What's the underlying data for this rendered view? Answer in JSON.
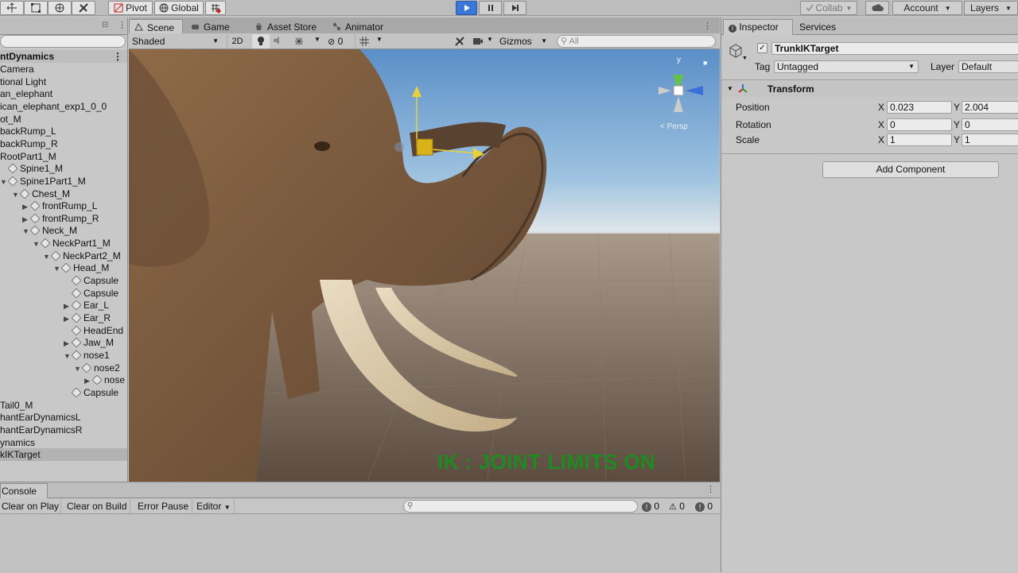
{
  "toolbar": {
    "pivot_label": "Pivot",
    "global_label": "Global",
    "collab_label": "Collab",
    "account_label": "Account",
    "layers_label": "Layers"
  },
  "scene_tabs": [
    {
      "label": "Scene"
    },
    {
      "label": "Game"
    },
    {
      "label": "Asset Store"
    },
    {
      "label": "Animator"
    }
  ],
  "scene_toolbar": {
    "shading": "Shaded",
    "mode_2d": "2D",
    "hidden_count": "0",
    "gizmos_label": "Gizmos",
    "search_placeholder": "All"
  },
  "scene_view": {
    "overlay_text": "IK : JOINT LIMITS ON",
    "overlay_color": "#1f8a1f",
    "persp_label": "< Persp",
    "axis_y_label": "y"
  },
  "hierarchy": {
    "root_label": "ntDynamics",
    "items": [
      {
        "label": "Camera",
        "indent": 0
      },
      {
        "label": "tional Light",
        "indent": 0
      },
      {
        "label": "an_elephant",
        "indent": 0
      },
      {
        "label": "ican_elephant_exp1_0_0",
        "indent": 0
      },
      {
        "label": "ot_M",
        "indent": 0
      },
      {
        "label": "backRump_L",
        "indent": 0
      },
      {
        "label": "backRump_R",
        "indent": 0
      },
      {
        "label": "RootPart1_M",
        "indent": 0
      },
      {
        "label": "Spine1_M",
        "indent": 0
      },
      {
        "label": "Spine1Part1_M",
        "indent": 0
      },
      {
        "label": "Chest_M",
        "indent": 1
      },
      {
        "label": "frontRump_L",
        "indent": 2
      },
      {
        "label": "frontRump_R",
        "indent": 2
      },
      {
        "label": "Neck_M",
        "indent": 2
      },
      {
        "label": "NeckPart1_M",
        "indent": 3
      },
      {
        "label": "NeckPart2_M",
        "indent": 4
      },
      {
        "label": "Head_M",
        "indent": 5
      },
      {
        "label": "Capsule",
        "indent": 6
      },
      {
        "label": "Capsule",
        "indent": 6
      },
      {
        "label": "Ear_L",
        "indent": 6
      },
      {
        "label": "Ear_R",
        "indent": 6
      },
      {
        "label": "HeadEnd",
        "indent": 6
      },
      {
        "label": "Jaw_M",
        "indent": 6
      },
      {
        "label": "nose1",
        "indent": 6
      },
      {
        "label": "nose2",
        "indent": 7
      },
      {
        "label": "nose",
        "indent": 8
      },
      {
        "label": "Capsule",
        "indent": 6
      },
      {
        "label": "Tail0_M",
        "indent": 0
      },
      {
        "label": "hantEarDynamicsL",
        "indent": 0
      },
      {
        "label": "hantEarDynamicsR",
        "indent": 0
      },
      {
        "label": "ynamics",
        "indent": 0
      },
      {
        "label": "kIKTarget",
        "indent": 0
      }
    ]
  },
  "console": {
    "tab_label": "Console",
    "clear_on_play": "Clear on Play",
    "clear_on_build": "Clear on Build",
    "error_pause": "Error Pause",
    "editor_label": "Editor",
    "info_count": "0",
    "warn_count": "0",
    "error_count": "0"
  },
  "inspector": {
    "tab_label": "Inspector",
    "services_label": "Services",
    "object_name": "TrunkIKTarget",
    "tag_label": "Tag",
    "tag_value": "Untagged",
    "layer_label": "Layer",
    "layer_value": "Default",
    "transform_label": "Transform",
    "position_label": "Position",
    "rotation_label": "Rotation",
    "scale_label": "Scale",
    "x_label": "X",
    "y_label": "Y",
    "position_x": "0.023",
    "position_y": "2.004",
    "rotation_x": "0",
    "rotation_y": "0",
    "scale_x": "1",
    "scale_y": "1",
    "add_component_label": "Add Component"
  }
}
